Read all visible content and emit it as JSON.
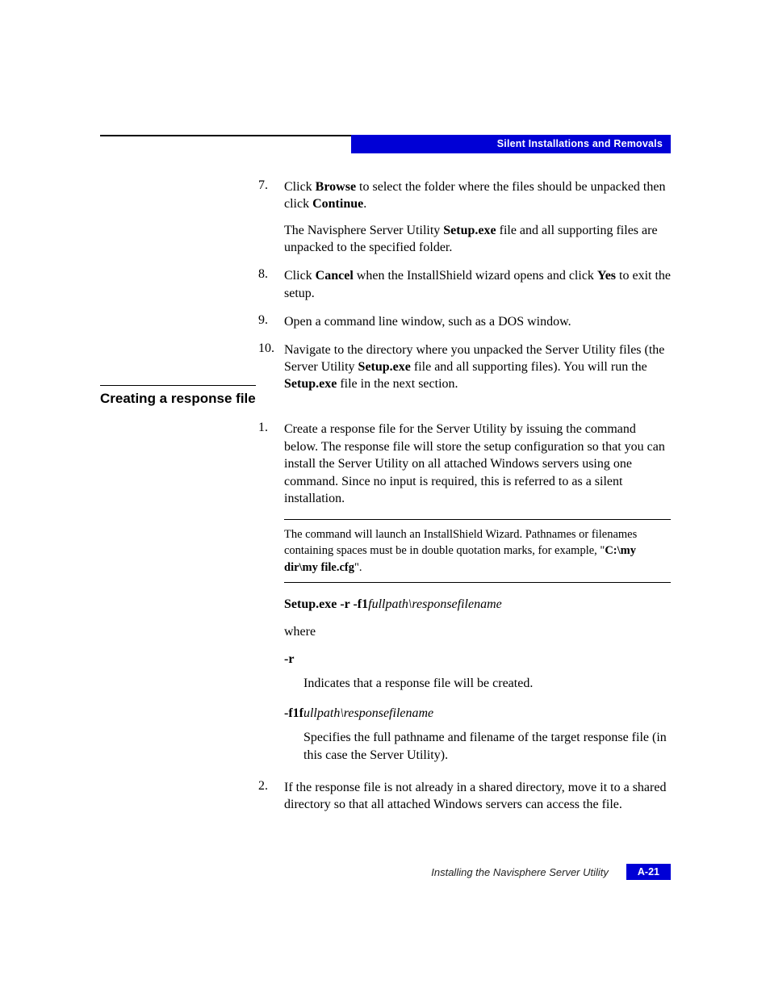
{
  "header": {
    "section_label": "Silent Installations and Removals"
  },
  "steps_a": [
    {
      "num": "7.",
      "paras": [
        {
          "parts": [
            {
              "t": "Click "
            },
            {
              "t": "Browse",
              "b": true
            },
            {
              "t": " to select the folder where the files should be unpacked then click "
            },
            {
              "t": "Continue",
              "b": true
            },
            {
              "t": "."
            }
          ]
        },
        {
          "parts": [
            {
              "t": "The Navisphere Server Utility "
            },
            {
              "t": "Setup.exe",
              "b": true
            },
            {
              "t": " file and all supporting files are unpacked to the specified folder."
            }
          ]
        }
      ]
    },
    {
      "num": "8.",
      "paras": [
        {
          "parts": [
            {
              "t": "Click "
            },
            {
              "t": "Cancel",
              "b": true
            },
            {
              "t": " when the InstallShield wizard opens and click "
            },
            {
              "t": "Yes",
              "b": true
            },
            {
              "t": " to exit the setup."
            }
          ]
        }
      ]
    },
    {
      "num": "9.",
      "paras": [
        {
          "parts": [
            {
              "t": "Open a command line window, such as a DOS window."
            }
          ]
        }
      ]
    },
    {
      "num": "10.",
      "paras": [
        {
          "parts": [
            {
              "t": "Navigate to the directory where you unpacked the Server Utility files (the Server Utility "
            },
            {
              "t": "Setup.exe",
              "b": true
            },
            {
              "t": " file and all supporting files). You will run the "
            },
            {
              "t": "Setup.exe",
              "b": true
            },
            {
              "t": " file in the next section."
            }
          ]
        }
      ]
    }
  ],
  "section_heading": "Creating a response file",
  "steps_b": [
    {
      "num": "1.",
      "paras": [
        {
          "parts": [
            {
              "t": "Create a response file for the Server Utility by issuing the command below. The response file will store the setup configuration so that you can install the Server Utility on all attached Windows servers using one command. Since no input is required, this is referred to as a silent installation."
            }
          ]
        }
      ]
    }
  ],
  "note": {
    "parts": [
      {
        "t": "The command will launch an InstallShield Wizard. Pathnames or filenames containing spaces must be in double quotation marks, for example, \""
      },
      {
        "t": "C:\\my dir\\my file.cfg",
        "b": true
      },
      {
        "t": "\"."
      }
    ]
  },
  "command": {
    "parts": [
      {
        "t": "Setup.exe -r -f1",
        "b": true
      },
      {
        "t": "fullpath\\responsefilename",
        "it": true
      }
    ]
  },
  "where_label": "where",
  "defs": [
    {
      "term_parts": [
        {
          "t": "-r",
          "b": true
        }
      ],
      "desc": "Indicates that a response file will be created."
    },
    {
      "term_parts": [
        {
          "t": "-f1",
          "b": true
        },
        {
          "t": "f"
        },
        {
          "t": "ullpath\\responsefilename",
          "it": true
        }
      ],
      "desc": "Specifies the full pathname and filename of the target response file (in this case the Server Utility)."
    }
  ],
  "steps_c": [
    {
      "num": "2.",
      "paras": [
        {
          "parts": [
            {
              "t": "If the response file is not already in a shared directory, move it to a shared directory so that all attached Windows servers can access the file."
            }
          ]
        }
      ]
    }
  ],
  "footer": {
    "title": "Installing the Navisphere Server Utility",
    "page": "A-21"
  }
}
